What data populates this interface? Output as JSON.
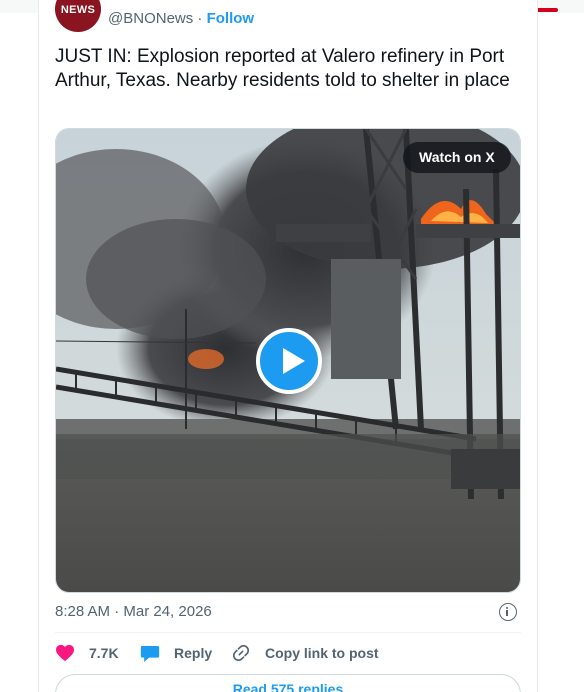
{
  "account": {
    "avatar_text": "NEWS",
    "handle": "@BNONews",
    "separator": "·",
    "follow_label": "Follow"
  },
  "tweet": {
    "text": "JUST IN: Explosion reported at Valero refinery in Port Arthur, Texas. Nearby residents told to shelter in place",
    "timestamp": "8:28 AM · Mar 24, 2026"
  },
  "media": {
    "watch_label": "Watch on X"
  },
  "actions": {
    "like_count": "7.7K",
    "reply_label": "Reply",
    "copy_label": "Copy link to post"
  },
  "replies_button": "Read 575 replies",
  "colors": {
    "accent": "#1d9bf0",
    "like": "#f91880",
    "brand": "#8a1420"
  }
}
